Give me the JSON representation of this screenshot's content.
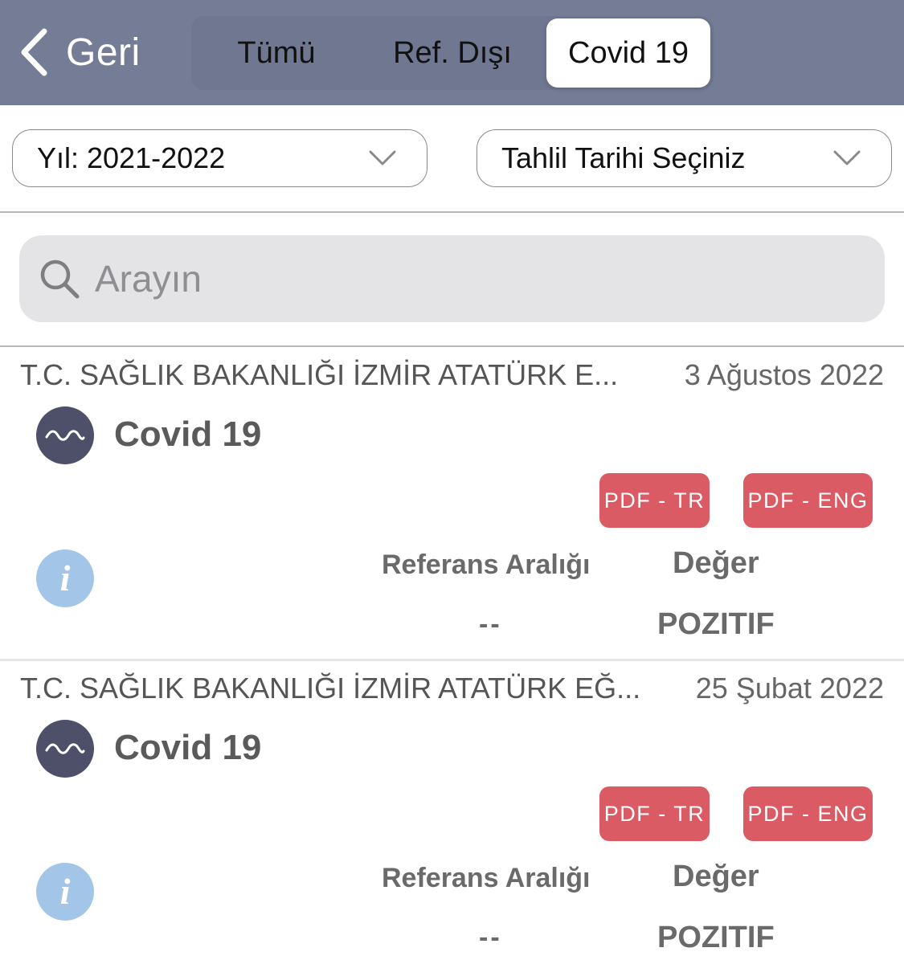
{
  "nav": {
    "back_label": "Geri",
    "tabs": [
      {
        "label": "Tümü",
        "active": false
      },
      {
        "label": "Ref. Dışı",
        "active": false
      },
      {
        "label": "Covid 19",
        "active": true
      }
    ]
  },
  "filters": {
    "year": "Yıl: 2021-2022",
    "date": "Tahlil Tarihi Seçiniz"
  },
  "search": {
    "placeholder": "Arayın"
  },
  "results": [
    {
      "institution": "T.C. SAĞLIK BAKANLIĞI İZMİR ATATÜRK E...",
      "date": "3 Ağustos 2022",
      "test_name": "Covid 19",
      "pdf_tr": "PDF - TR",
      "pdf_eng": "PDF - ENG",
      "ref_header": "Referans Aralığı",
      "value_header": "Değer",
      "ref_value": "--",
      "value": "POZITIF"
    },
    {
      "institution": "T.C. SAĞLIK BAKANLIĞI İZMİR ATATÜRK EĞ...",
      "date": "25 Şubat 2022",
      "test_name": "Covid 19",
      "pdf_tr": "PDF - TR",
      "pdf_eng": "PDF - ENG",
      "ref_header": "Referans Aralığı",
      "value_header": "Değer",
      "ref_value": "--",
      "value": "POZITIF"
    }
  ],
  "icons": {
    "back": "chevron-left-icon",
    "dropdown": "chevron-down-icon",
    "search": "search-icon",
    "test": "wave-icon",
    "info": "info-icon"
  },
  "colors": {
    "navbar": "#747c96",
    "pdf_button": "#db5b65",
    "avatar": "#4d5068",
    "info": "#a3c6e8"
  }
}
